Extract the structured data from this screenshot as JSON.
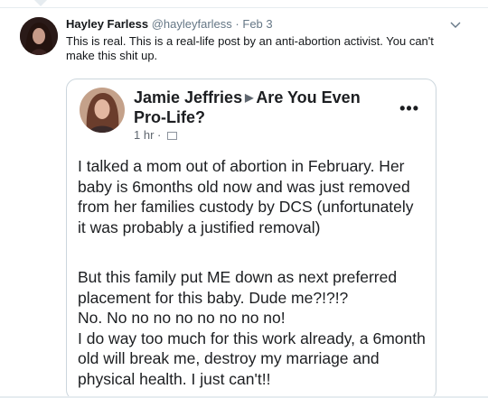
{
  "tweet": {
    "display_name": "Hayley Farless",
    "handle": "@hayleyfarless",
    "separator": "·",
    "date": "Feb 3",
    "text": "This is real. This is a real-life post by an anti-abortion activist. You can't make this shit up."
  },
  "embedded_post": {
    "author": "Jamie Jeffries",
    "group": "Are You Even Pro-Life?",
    "time": "1 hr ·",
    "paragraph_1": "I talked a mom out of abortion in February. Her baby is 6months old now and was just removed from her families custody by DCS (unfortunately it was probably a justified removal)",
    "paragraph_2_line_1": "But this family put ME down as next preferred placement for this baby. Dude me?!?!?",
    "paragraph_2_line_2": "No. No no no no no no no no!",
    "paragraph_2_line_3": "I do way too much for this work already, a 6month old will break me, destroy my marriage and physical health. I just can't!!",
    "menu_glyph": "•••"
  },
  "icons": {
    "caret": "chevron-down-icon",
    "fb_arrow": "▶"
  },
  "colors": {
    "text_primary": "#14171a",
    "text_secondary": "#657786",
    "card_border": "#ccd6dd",
    "fb_text": "#1c1e21"
  }
}
